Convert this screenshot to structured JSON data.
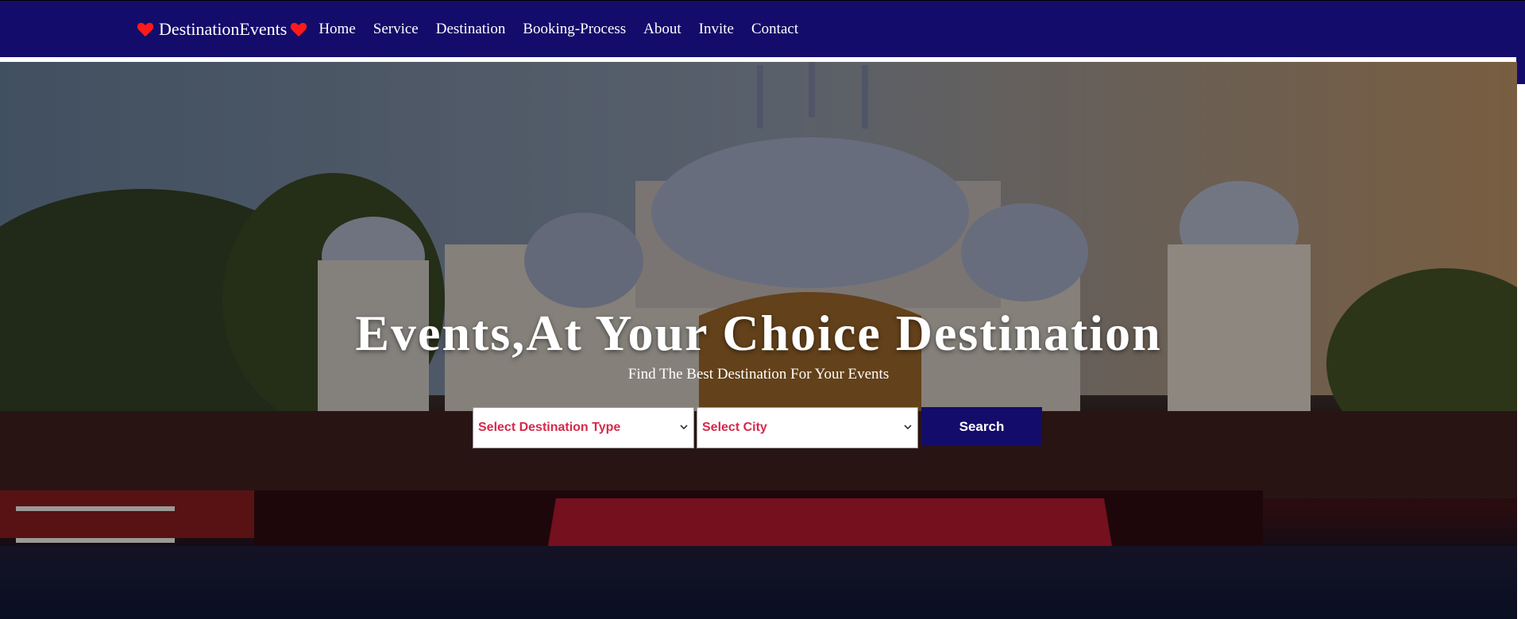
{
  "brand": {
    "name": "DestinationEvents",
    "icon": "heart-icon",
    "accent_color": "#ff1a1a"
  },
  "nav": {
    "background": "#140c6b",
    "links": [
      "Home",
      "Service",
      "Destination",
      "Booking-Process",
      "About",
      "Invite",
      "Contact"
    ]
  },
  "hero": {
    "title": "Events,At Your Choice Destination",
    "subtitle": "Find The Best Destination For Your Events"
  },
  "search": {
    "destination_type_selected": "Select Destination Type",
    "city_selected": "Select City",
    "button_label": "Search",
    "select_text_color": "#d6294a",
    "button_color": "#140c6b"
  }
}
